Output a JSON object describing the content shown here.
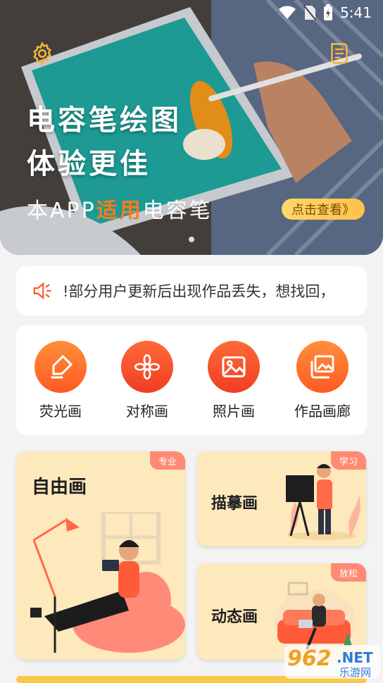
{
  "status": {
    "time": "5:41"
  },
  "banner": {
    "title_line1": "电容笔绘图",
    "title_line2": "体验更佳",
    "sub_prefix": "本APP",
    "sub_highlight": "适用",
    "sub_suffix": "电容笔",
    "link": "点击查看》"
  },
  "notice": {
    "text": "!部分用户更新后出现作品丢失，想找回，"
  },
  "tools": [
    {
      "label": "荧光画",
      "icon": "highlighter-icon"
    },
    {
      "label": "对称画",
      "icon": "symmetry-flower-icon"
    },
    {
      "label": "照片画",
      "icon": "photo-icon"
    },
    {
      "label": "作品画廊",
      "icon": "gallery-icon"
    }
  ],
  "cards": {
    "free": {
      "title": "自由画",
      "badge": "专业"
    },
    "trace": {
      "title": "描摹画",
      "badge": "学习"
    },
    "motion": {
      "title": "动态画",
      "badge": "放松"
    }
  },
  "watermark": {
    "text1": "962",
    "text2": ".NET",
    "text3": "乐游网"
  },
  "colors": {
    "accent": "#ff6a2a",
    "card_bg": "#fde9bc",
    "badge": "#ff8a73"
  }
}
